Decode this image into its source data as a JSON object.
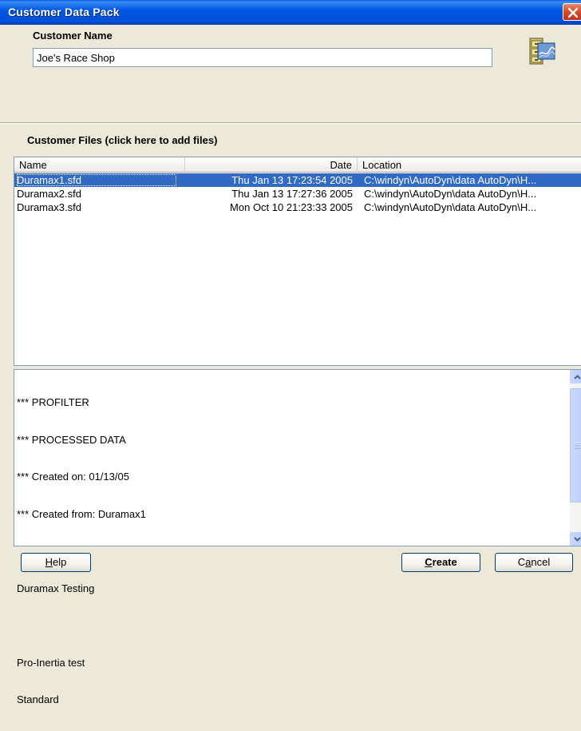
{
  "window": {
    "title": "Customer Data Pack"
  },
  "customer": {
    "label": "Customer Name",
    "value": "Joe's Race Shop"
  },
  "files": {
    "label": "Customer Files (click here to add files)",
    "columns": {
      "name": "Name",
      "date": "Date",
      "location": "Location"
    },
    "rows": [
      {
        "name": "Duramax1.sfd",
        "date": "Thu Jan 13 17:23:54 2005",
        "location": "C:\\windyn\\AutoDyn\\data AutoDyn\\H...",
        "selected": true
      },
      {
        "name": "Duramax2.sfd",
        "date": "Thu Jan 13 17:27:36 2005",
        "location": "C:\\windyn\\AutoDyn\\data AutoDyn\\H...",
        "selected": false
      },
      {
        "name": "Duramax3.sfd",
        "date": "Mon Oct 10 21:23:33 2005",
        "location": "C:\\windyn\\AutoDyn\\data AutoDyn\\H...",
        "selected": false
      }
    ]
  },
  "notes": {
    "lines": [
      "*** PROFILTER",
      "*** PROCESSED DATA",
      "*** Created on: 01/13/05",
      "*** Created from: Duramax1",
      "",
      "Duramax Testing",
      "",
      "Pro-Inertia test",
      "Standard"
    ]
  },
  "buttons": {
    "help": {
      "mnemonic": "H",
      "rest": "elp"
    },
    "create": {
      "mnemonic": "C",
      "rest": "reate"
    },
    "cancel": {
      "pre": "C",
      "mnemonic": "a",
      "rest": "ncel"
    }
  },
  "icons": {
    "close": "close-icon",
    "cabinet": "file-cabinet-icon",
    "scroll_up": "scroll-up-arrow-icon",
    "scroll_down": "scroll-down-arrow-icon"
  },
  "colors": {
    "titlebar": "#0058E6",
    "selection": "#316AC5",
    "close_button": "#D4492A",
    "dialog_bg": "#ECE9D8"
  }
}
